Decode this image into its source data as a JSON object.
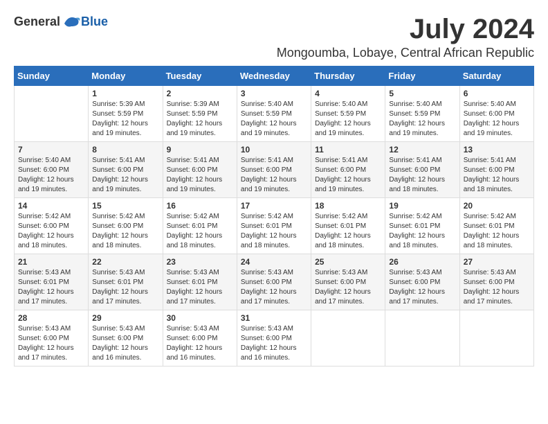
{
  "header": {
    "logo_general": "General",
    "logo_blue": "Blue",
    "month_year": "July 2024",
    "location": "Mongoumba, Lobaye, Central African Republic"
  },
  "weekdays": [
    "Sunday",
    "Monday",
    "Tuesday",
    "Wednesday",
    "Thursday",
    "Friday",
    "Saturday"
  ],
  "weeks": [
    [
      {
        "day": "",
        "info": ""
      },
      {
        "day": "1",
        "info": "Sunrise: 5:39 AM\nSunset: 5:59 PM\nDaylight: 12 hours\nand 19 minutes."
      },
      {
        "day": "2",
        "info": "Sunrise: 5:39 AM\nSunset: 5:59 PM\nDaylight: 12 hours\nand 19 minutes."
      },
      {
        "day": "3",
        "info": "Sunrise: 5:40 AM\nSunset: 5:59 PM\nDaylight: 12 hours\nand 19 minutes."
      },
      {
        "day": "4",
        "info": "Sunrise: 5:40 AM\nSunset: 5:59 PM\nDaylight: 12 hours\nand 19 minutes."
      },
      {
        "day": "5",
        "info": "Sunrise: 5:40 AM\nSunset: 5:59 PM\nDaylight: 12 hours\nand 19 minutes."
      },
      {
        "day": "6",
        "info": "Sunrise: 5:40 AM\nSunset: 6:00 PM\nDaylight: 12 hours\nand 19 minutes."
      }
    ],
    [
      {
        "day": "7",
        "info": "Sunrise: 5:40 AM\nSunset: 6:00 PM\nDaylight: 12 hours\nand 19 minutes."
      },
      {
        "day": "8",
        "info": "Sunrise: 5:41 AM\nSunset: 6:00 PM\nDaylight: 12 hours\nand 19 minutes."
      },
      {
        "day": "9",
        "info": "Sunrise: 5:41 AM\nSunset: 6:00 PM\nDaylight: 12 hours\nand 19 minutes."
      },
      {
        "day": "10",
        "info": "Sunrise: 5:41 AM\nSunset: 6:00 PM\nDaylight: 12 hours\nand 19 minutes."
      },
      {
        "day": "11",
        "info": "Sunrise: 5:41 AM\nSunset: 6:00 PM\nDaylight: 12 hours\nand 19 minutes."
      },
      {
        "day": "12",
        "info": "Sunrise: 5:41 AM\nSunset: 6:00 PM\nDaylight: 12 hours\nand 18 minutes."
      },
      {
        "day": "13",
        "info": "Sunrise: 5:41 AM\nSunset: 6:00 PM\nDaylight: 12 hours\nand 18 minutes."
      }
    ],
    [
      {
        "day": "14",
        "info": "Sunrise: 5:42 AM\nSunset: 6:00 PM\nDaylight: 12 hours\nand 18 minutes."
      },
      {
        "day": "15",
        "info": "Sunrise: 5:42 AM\nSunset: 6:00 PM\nDaylight: 12 hours\nand 18 minutes."
      },
      {
        "day": "16",
        "info": "Sunrise: 5:42 AM\nSunset: 6:01 PM\nDaylight: 12 hours\nand 18 minutes."
      },
      {
        "day": "17",
        "info": "Sunrise: 5:42 AM\nSunset: 6:01 PM\nDaylight: 12 hours\nand 18 minutes."
      },
      {
        "day": "18",
        "info": "Sunrise: 5:42 AM\nSunset: 6:01 PM\nDaylight: 12 hours\nand 18 minutes."
      },
      {
        "day": "19",
        "info": "Sunrise: 5:42 AM\nSunset: 6:01 PM\nDaylight: 12 hours\nand 18 minutes."
      },
      {
        "day": "20",
        "info": "Sunrise: 5:42 AM\nSunset: 6:01 PM\nDaylight: 12 hours\nand 18 minutes."
      }
    ],
    [
      {
        "day": "21",
        "info": "Sunrise: 5:43 AM\nSunset: 6:01 PM\nDaylight: 12 hours\nand 17 minutes."
      },
      {
        "day": "22",
        "info": "Sunrise: 5:43 AM\nSunset: 6:01 PM\nDaylight: 12 hours\nand 17 minutes."
      },
      {
        "day": "23",
        "info": "Sunrise: 5:43 AM\nSunset: 6:01 PM\nDaylight: 12 hours\nand 17 minutes."
      },
      {
        "day": "24",
        "info": "Sunrise: 5:43 AM\nSunset: 6:00 PM\nDaylight: 12 hours\nand 17 minutes."
      },
      {
        "day": "25",
        "info": "Sunrise: 5:43 AM\nSunset: 6:00 PM\nDaylight: 12 hours\nand 17 minutes."
      },
      {
        "day": "26",
        "info": "Sunrise: 5:43 AM\nSunset: 6:00 PM\nDaylight: 12 hours\nand 17 minutes."
      },
      {
        "day": "27",
        "info": "Sunrise: 5:43 AM\nSunset: 6:00 PM\nDaylight: 12 hours\nand 17 minutes."
      }
    ],
    [
      {
        "day": "28",
        "info": "Sunrise: 5:43 AM\nSunset: 6:00 PM\nDaylight: 12 hours\nand 17 minutes."
      },
      {
        "day": "29",
        "info": "Sunrise: 5:43 AM\nSunset: 6:00 PM\nDaylight: 12 hours\nand 16 minutes."
      },
      {
        "day": "30",
        "info": "Sunrise: 5:43 AM\nSunset: 6:00 PM\nDaylight: 12 hours\nand 16 minutes."
      },
      {
        "day": "31",
        "info": "Sunrise: 5:43 AM\nSunset: 6:00 PM\nDaylight: 12 hours\nand 16 minutes."
      },
      {
        "day": "",
        "info": ""
      },
      {
        "day": "",
        "info": ""
      },
      {
        "day": "",
        "info": ""
      }
    ]
  ]
}
